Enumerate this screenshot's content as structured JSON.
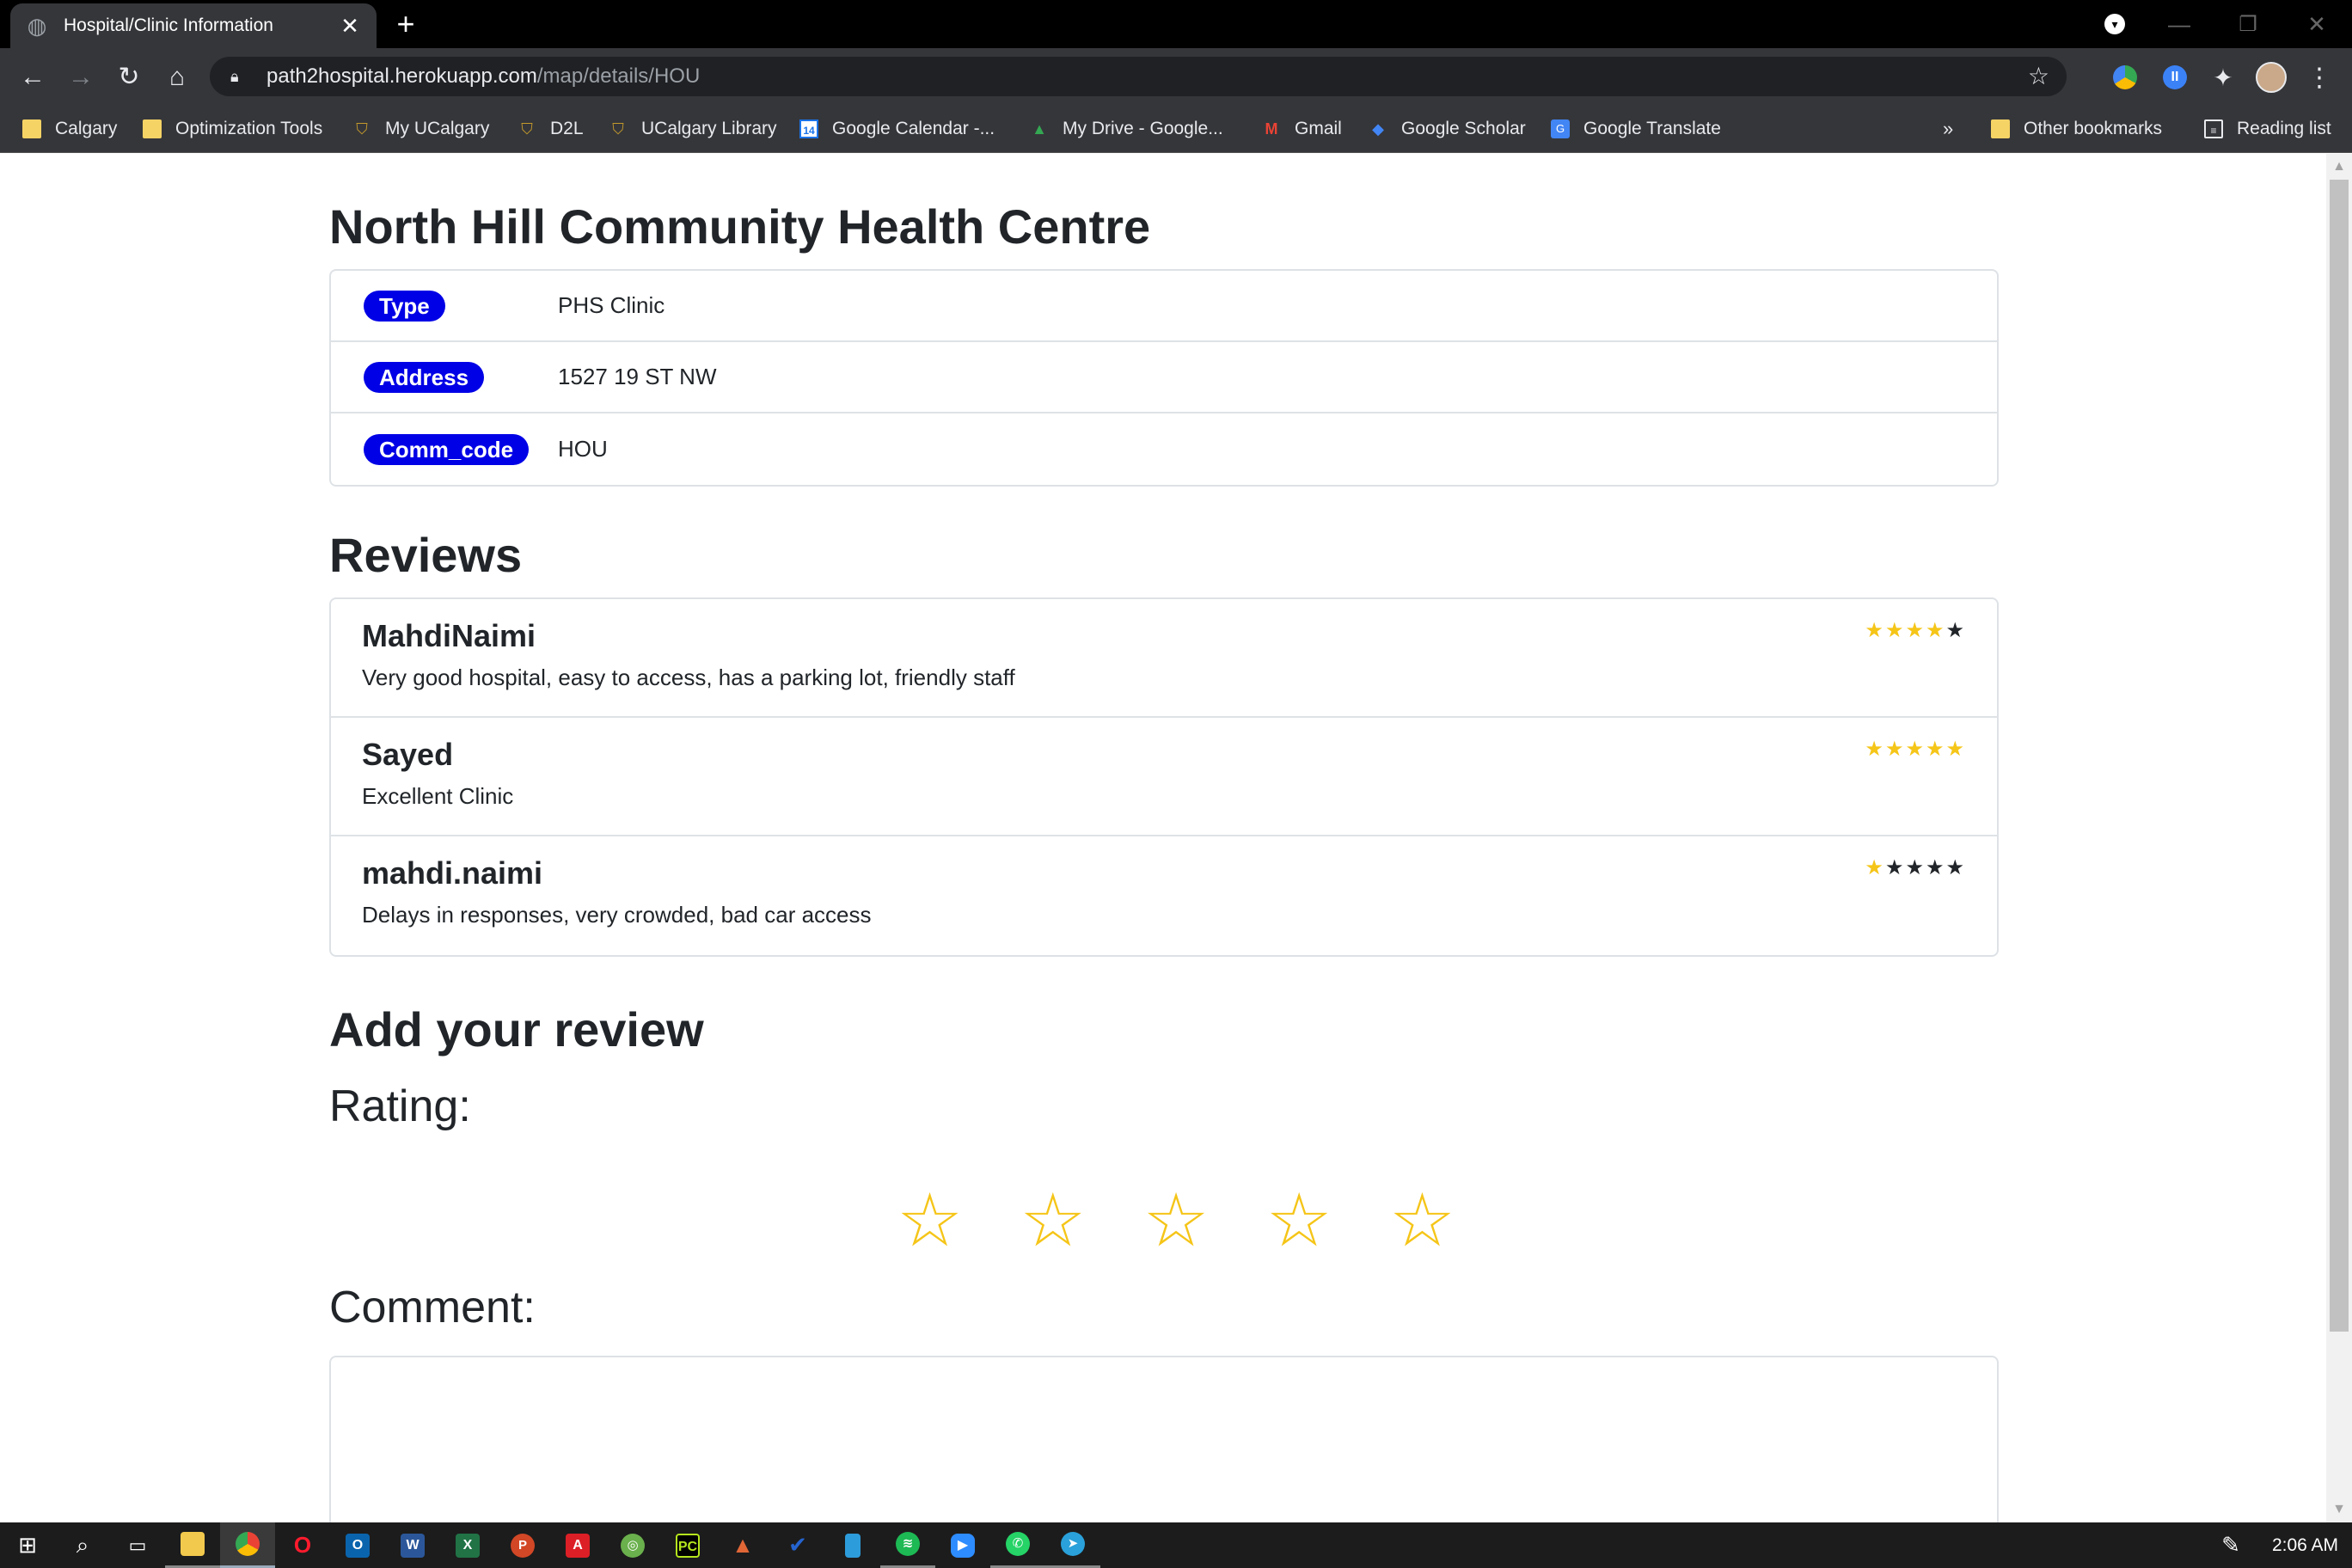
{
  "browser": {
    "tab_title": "Hospital/Clinic Information",
    "tab_close": "✕",
    "new_tab": "+",
    "url_host": "path2hospital.herokuapp.com",
    "url_path": "/map/details/HOU",
    "bookmarks": [
      {
        "label": "Calgary",
        "icon": "folder-icon"
      },
      {
        "label": "Optimization Tools",
        "icon": "folder-icon"
      },
      {
        "label": "My UCalgary",
        "icon": "ucalgary-shield-icon"
      },
      {
        "label": "D2L",
        "icon": "ucalgary-shield-icon"
      },
      {
        "label": "UCalgary Library",
        "icon": "ucalgary-shield-icon"
      },
      {
        "label": "Google Calendar -...",
        "icon": "google-calendar-icon"
      },
      {
        "label": "My Drive - Google...",
        "icon": "google-drive-icon"
      },
      {
        "label": "Gmail",
        "icon": "gmail-icon"
      },
      {
        "label": "Google Scholar",
        "icon": "google-scholar-icon"
      },
      {
        "label": "Google Translate",
        "icon": "google-translate-icon"
      }
    ],
    "bookmarks_overflow": "»",
    "other_bookmarks": "Other bookmarks",
    "reading_list": "Reading list",
    "calendar_icon_text": "14"
  },
  "page": {
    "title": "North Hill Community Health Centre",
    "info": [
      {
        "label": "Type",
        "value": "PHS Clinic"
      },
      {
        "label": "Address",
        "value": "1527 19 ST NW"
      },
      {
        "label": "Comm_code",
        "value": "HOU"
      }
    ],
    "reviews_heading": "Reviews",
    "reviews": [
      {
        "author": "MahdiNaimi",
        "comment": "Very good hospital, easy to access, has a parking lot, friendly staff",
        "rating": 4,
        "max": 5
      },
      {
        "author": "Sayed",
        "comment": "Excellent Clinic",
        "rating": 5,
        "max": 5
      },
      {
        "author": "mahdi.naimi",
        "comment": "Delays in responses, very crowded, bad car access",
        "rating": 1,
        "max": 5
      }
    ],
    "add_review_heading": "Add your review",
    "rating_label": "Rating:",
    "rating_input_stars": 5,
    "comment_label": "Comment:",
    "comment_value": ""
  },
  "colors": {
    "pill_bg": "#0000e6",
    "star_filled": "#f5c518",
    "star_empty": "#212529"
  },
  "taskbar": {
    "clock": "2:06 AM"
  }
}
